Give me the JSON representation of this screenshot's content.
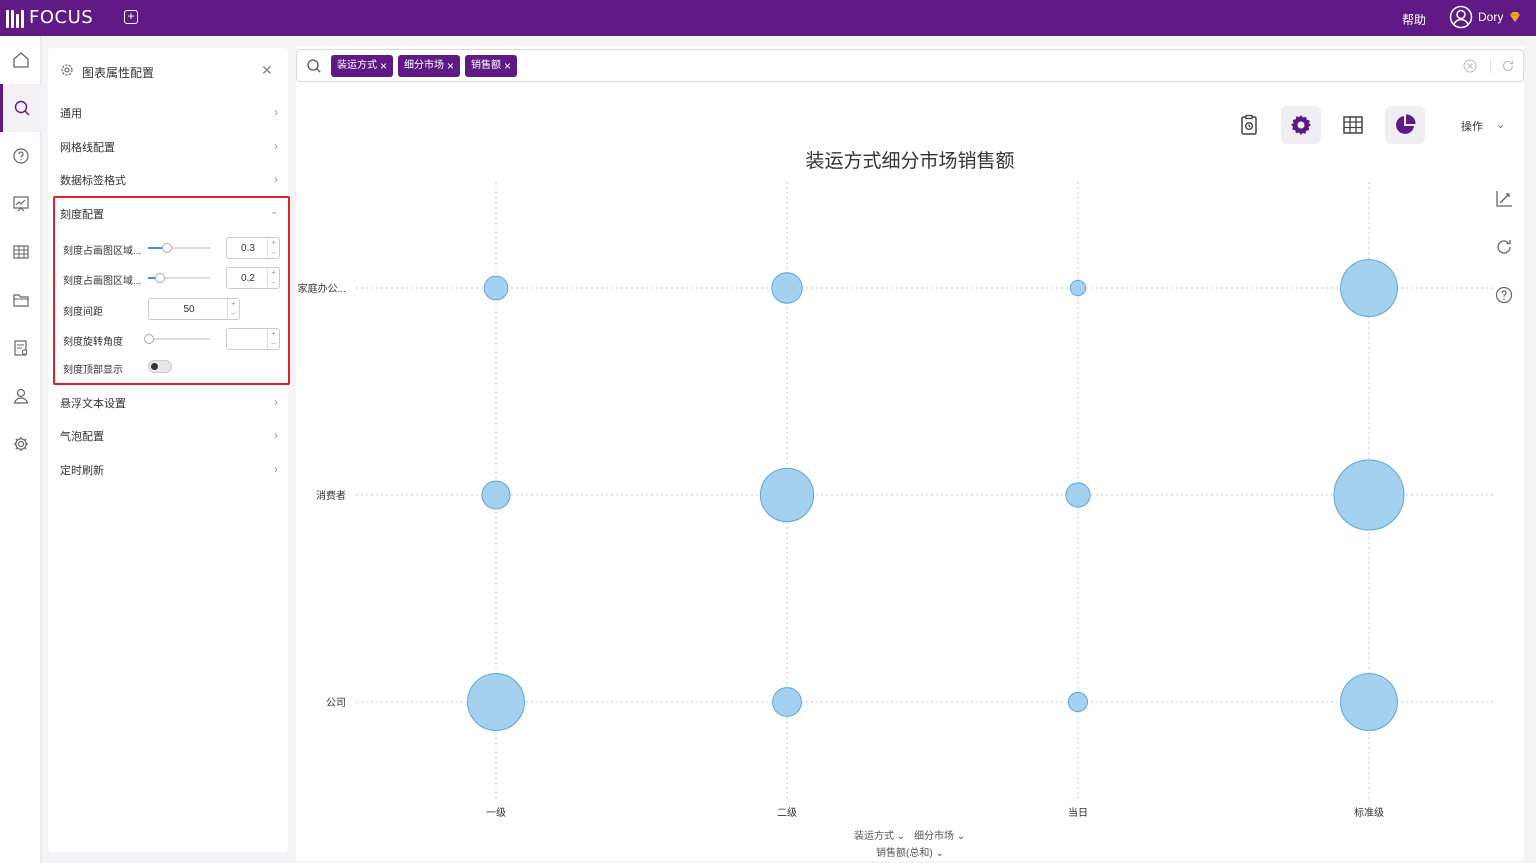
{
  "app": {
    "brand": "FOCUS",
    "help": "帮助",
    "user": "Dory"
  },
  "panel": {
    "title": "图表属性配置",
    "sections": [
      {
        "label": "通用"
      },
      {
        "label": "网格线配置"
      },
      {
        "label": "数据标签格式"
      },
      {
        "label": "刻度配置"
      },
      {
        "label": "悬浮文本设置"
      },
      {
        "label": "气泡配置"
      },
      {
        "label": "定时刷新"
      }
    ],
    "scale": {
      "row1_label": "刻度占画图区域...",
      "row1_value": "0.3",
      "row1_level": 0.3,
      "row2_label": "刻度占画图区域...",
      "row2_value": "0.2",
      "row2_level": 0.2,
      "spacing_label": "刻度间距",
      "spacing_value": "50",
      "rotate_label": "刻度旋转角度",
      "rotate_value": "",
      "top_label": "刻度顶部显示",
      "top_on": false
    }
  },
  "search": {
    "chips": [
      "装运方式",
      "细分市场",
      "销售额"
    ]
  },
  "toolbar": {
    "ops": "操作"
  },
  "chart_data": {
    "type": "scatter",
    "title": "装运方式细分市场销售额",
    "x_categories": [
      "一级",
      "二级",
      "当日",
      "标准级"
    ],
    "y_categories": [
      "公司",
      "消费者",
      "家庭办公..."
    ],
    "x_field": "装运方式",
    "y_field": "细分市场",
    "size_field": "销售额(总和)",
    "bubble_color": "#9fcfef",
    "bubble_stroke": "#5aa8dc",
    "points": [
      {
        "x": "一级",
        "y": "家庭办公...",
        "size": 0.115
      },
      {
        "x": "二级",
        "y": "家庭办公...",
        "size": 0.19
      },
      {
        "x": "当日",
        "y": "家庭办公...",
        "size": 0.048
      },
      {
        "x": "标准级",
        "y": "家庭办公...",
        "size": 0.66
      },
      {
        "x": "一级",
        "y": "消费者",
        "size": 0.16
      },
      {
        "x": "二级",
        "y": "消费者",
        "size": 0.58
      },
      {
        "x": "当日",
        "y": "消费者",
        "size": 0.12
      },
      {
        "x": "标准级",
        "y": "消费者",
        "size": 1.0
      },
      {
        "x": "一级",
        "y": "公司",
        "size": 0.66
      },
      {
        "x": "二级",
        "y": "公司",
        "size": 0.17
      },
      {
        "x": "当日",
        "y": "公司",
        "size": 0.075
      },
      {
        "x": "标准级",
        "y": "公司",
        "size": 0.66
      }
    ]
  }
}
